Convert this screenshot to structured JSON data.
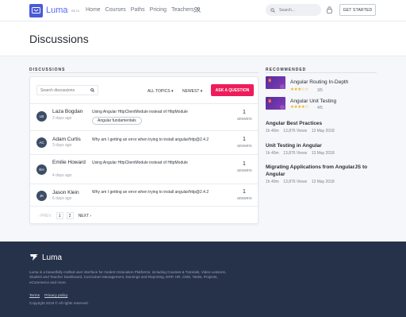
{
  "brand": {
    "name": "Luma",
    "beta": "BETA"
  },
  "nav": {
    "links": [
      "Home",
      "Courses",
      "Paths",
      "Pricing",
      "Teachers"
    ],
    "search_placeholder": "Search...",
    "get_started": "GET STARTED"
  },
  "page": {
    "title": "Discussions"
  },
  "discussions": {
    "section_label": "DISCUSSIONS",
    "search_placeholder": "Search discussions",
    "filter_topics": "ALL TOPICS",
    "filter_sort": "NEWEST",
    "ask_button": "ASK A QUESTION",
    "rows": [
      {
        "initials": "LB",
        "name": "Laza Bogdan",
        "time": "2 days ago",
        "title": "Using Angular HttpClientModule instead of HttpModule",
        "tag": "Angular fundamentals",
        "answers": "1",
        "answers_label": "answers"
      },
      {
        "initials": "AC",
        "name": "Adam Curtis",
        "time": "3 days ago",
        "title": "Why am I getting an error when trying to install angular/http@2.4.2",
        "tag": "",
        "answers": "1",
        "answers_label": "answers"
      },
      {
        "initials": "EH",
        "name": "Emilie Howard",
        "time": "4 days ago",
        "title": "Using Angular HttpClientModule instead of HttpModule",
        "tag": "",
        "answers": "1",
        "answers_label": "answers"
      },
      {
        "initials": "JK",
        "name": "Jason Klein",
        "time": "6 days ago",
        "title": "Why am I getting an error when trying to install angular/http@2.4.2",
        "tag": "",
        "answers": "1",
        "answers_label": "answers"
      }
    ],
    "pagination": {
      "prev": "PREV",
      "pages": [
        "1",
        "2"
      ],
      "next": "NEXT"
    }
  },
  "recommended": {
    "section_label": "RECOMMENDED",
    "courses": [
      {
        "title": "Angular Routing In-Depth",
        "rating": "3/5",
        "stars": 3
      },
      {
        "title": "Angular Unit Testing",
        "rating": "4/5",
        "stars": 4
      }
    ],
    "articles": [
      {
        "title": "Angular Best Practices",
        "duration": "1h 40m",
        "views": "13,876 Views",
        "date": "13 May 2018"
      },
      {
        "title": "Unit Testing in Angular",
        "duration": "1h 40m",
        "views": "13,876 Views",
        "date": "13 May 2018"
      },
      {
        "title": "Migrating Applications from AngularJS to Angular",
        "duration": "1h 40m",
        "views": "13,876 Views",
        "date": "13 May 2018"
      }
    ]
  },
  "footer": {
    "brand": "Luma",
    "description": "Luma is a beautifully crafted user interface for modern Education Platforms, including Courses & Tutorials, Video Lessons, Student and Teacher Dashboard, Curriculum Management, Earnings and Reporting, ERP, HR, CMS, Tasks, Projects, eCommerce and more.",
    "links": [
      "Terms",
      "Privacy policy"
    ],
    "copyright": "Copyright 2019 © All rights reserved."
  },
  "colors": {
    "accent": "#5567ff",
    "ask": "#ee1c5a",
    "footer_bg": "#26324a",
    "star": "#f2b01e"
  }
}
